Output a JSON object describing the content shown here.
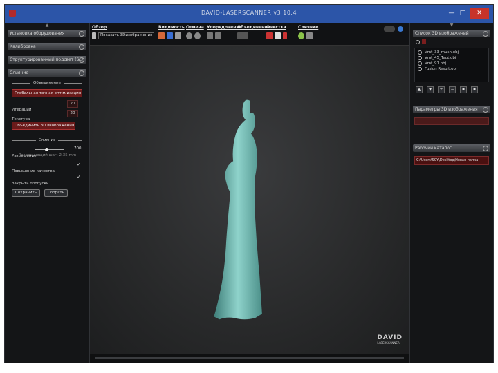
{
  "window": {
    "title": "DAVID-LASERSCANNER v3.10.4"
  },
  "toolbar": {
    "groups": [
      {
        "label": "Обзор",
        "button": "Показать 3Dизображение"
      },
      {
        "label": "Видимость"
      },
      {
        "label": "Отмена"
      },
      {
        "label": "Упорядочение"
      },
      {
        "label": "Объединение"
      },
      {
        "label": "Очистка"
      },
      {
        "label": "Слияние"
      }
    ]
  },
  "left_panel": {
    "headers": [
      "Установка оборудования",
      "Калибровка",
      "Структурированный подсвет (SL)",
      "Слияние"
    ],
    "combine_section": "Объединение",
    "method": "Глобальная точная оптимизация",
    "iterations_label": "Итерации",
    "iterations_value": "20",
    "texture_label": "Текстура",
    "texture_value": "20",
    "combine_button": "Объединить 3D изображения",
    "fusion_section": "Слияние",
    "resolution_label": "Разрешение",
    "resolution_value": "700",
    "resolution_note": "Разрешающий шаг: 2.35 mm",
    "quality_label": "Повышение качества",
    "holes_label": "Закрыть пропуски",
    "save_button": "Сохранить",
    "merge_button": "Собрать"
  },
  "right_panel": {
    "list_header": "Список 3D изображений",
    "items": [
      "Vmt_33_mush.obj",
      "Vmt_45_Teut.obj",
      "Vmt_91.obj",
      "Fusion Result.obj"
    ],
    "params_header": "Параметры 3D изображения",
    "workdir_header": "Рабочий каталог",
    "workdir_path": "C:\\Users\\SCY\\Desktop\\Новая папка"
  },
  "viewport": {
    "logo": "DAVID",
    "logo_sub": "LASERSCANNER"
  },
  "colors": {
    "titlebar": "#2c55a8",
    "model": "#7fc7c0",
    "accent_red": "#7a1e1e"
  }
}
